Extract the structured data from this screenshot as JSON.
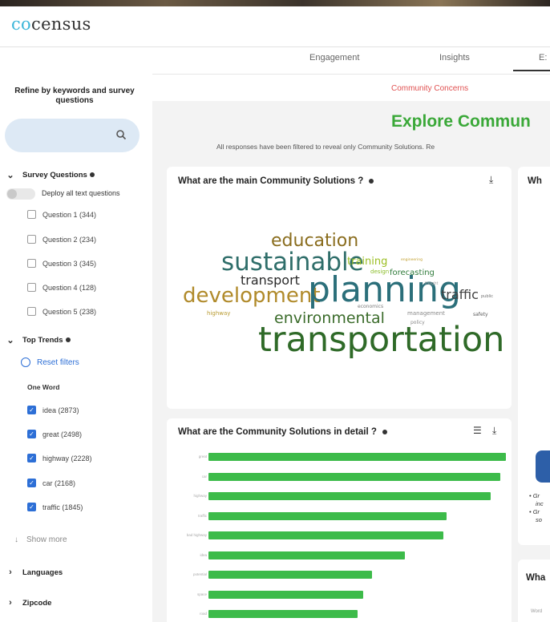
{
  "logo": {
    "co": "co",
    "rest": "census"
  },
  "tabs": [
    {
      "label": "Engagement"
    },
    {
      "label": "Insights"
    },
    {
      "label": "E:"
    }
  ],
  "sidebar": {
    "refine_title": "Refine by keywords and survey questions",
    "search_placeholder": "",
    "survey_questions": {
      "label": "Survey Questions",
      "deploy_label": "Deploy all text questions",
      "questions": [
        {
          "label": "Question 1 (344)"
        },
        {
          "label": "Question 2 (234)"
        },
        {
          "label": "Question 3 (345)"
        },
        {
          "label": "Question 4 (128)"
        },
        {
          "label": "Question 5 (238)"
        }
      ]
    },
    "top_trends": {
      "label": "Top Trends",
      "reset_label": "Reset filters",
      "one_word_label": "One Word",
      "words": [
        {
          "label": "idea (2873)",
          "checked": true
        },
        {
          "label": "great (2498)",
          "checked": true
        },
        {
          "label": "highway (2228)",
          "checked": true
        },
        {
          "label": "car (2168)",
          "checked": true
        },
        {
          "label": "traffic (1845)",
          "checked": true
        }
      ],
      "show_more": "Show more"
    },
    "languages_label": "Languages",
    "zipcode_label": "Zipcode"
  },
  "main": {
    "community_concerns": "Community Concerns",
    "explore_title": "Explore Commun",
    "filtered_note": "All responses have been filtered to reveal only Community Solutions. Re",
    "card1_title": "What are the main Community Solutions ?",
    "card2_title": "What are the Community Solutions in detail ?",
    "card3_title": "Wh",
    "card4_title": "Wha",
    "card4_sub": "Word",
    "bullets": [
      "Gr",
      "inc",
      "Gr",
      "so"
    ]
  },
  "word_cloud": [
    {
      "text": "education",
      "color": "#8a6d1e"
    },
    {
      "text": "sustainable",
      "color": "#2f6e6a"
    },
    {
      "text": "training",
      "color": "#9bbe22"
    },
    {
      "text": "forecasting",
      "color": "#2f7b3a"
    },
    {
      "text": "transport",
      "color": "#2a2a2a"
    },
    {
      "text": "development",
      "color": "#b08a2a"
    },
    {
      "text": "planning",
      "color": "#2b6f7a"
    },
    {
      "text": "traffic",
      "color": "#3f3f3f"
    },
    {
      "text": "environmental",
      "color": "#3a6b2a"
    },
    {
      "text": "transportation",
      "color": "#2f6a28"
    },
    {
      "text": "design",
      "color": "#8bbd2a"
    },
    {
      "text": "management",
      "color": "#888888"
    },
    {
      "text": "highway",
      "color": "#b89a30"
    },
    {
      "text": "economics",
      "color": "#7a7a7a"
    },
    {
      "text": "safety",
      "color": "#5a5a5a"
    },
    {
      "text": "policy",
      "color": "#8a8a8a"
    },
    {
      "text": "freight",
      "color": "#a0a0a0"
    },
    {
      "text": "engineering",
      "color": "#c2a030"
    },
    {
      "text": "public",
      "color": "#707070"
    }
  ],
  "chart_data": {
    "type": "bar",
    "orientation": "horizontal",
    "categories": [
      "great",
      "car",
      "highway",
      "traffic",
      "bad highway",
      "idea",
      "potential",
      "space",
      "road"
    ],
    "values": [
      100,
      98,
      95,
      80,
      79,
      66,
      55,
      52,
      50
    ],
    "xlim": [
      0,
      100
    ]
  },
  "colors": {
    "accent_green": "#3aa838",
    "bar_green": "#3dbb4a",
    "concerns_red": "#e05050",
    "link_blue": "#2d6fd6",
    "logo_blue": "#3bb6d9"
  },
  "icons": [
    "search-icon",
    "chevron-down-icon",
    "chevron-right-icon",
    "info-icon",
    "download-icon",
    "filter-icon",
    "reset-icon"
  ]
}
